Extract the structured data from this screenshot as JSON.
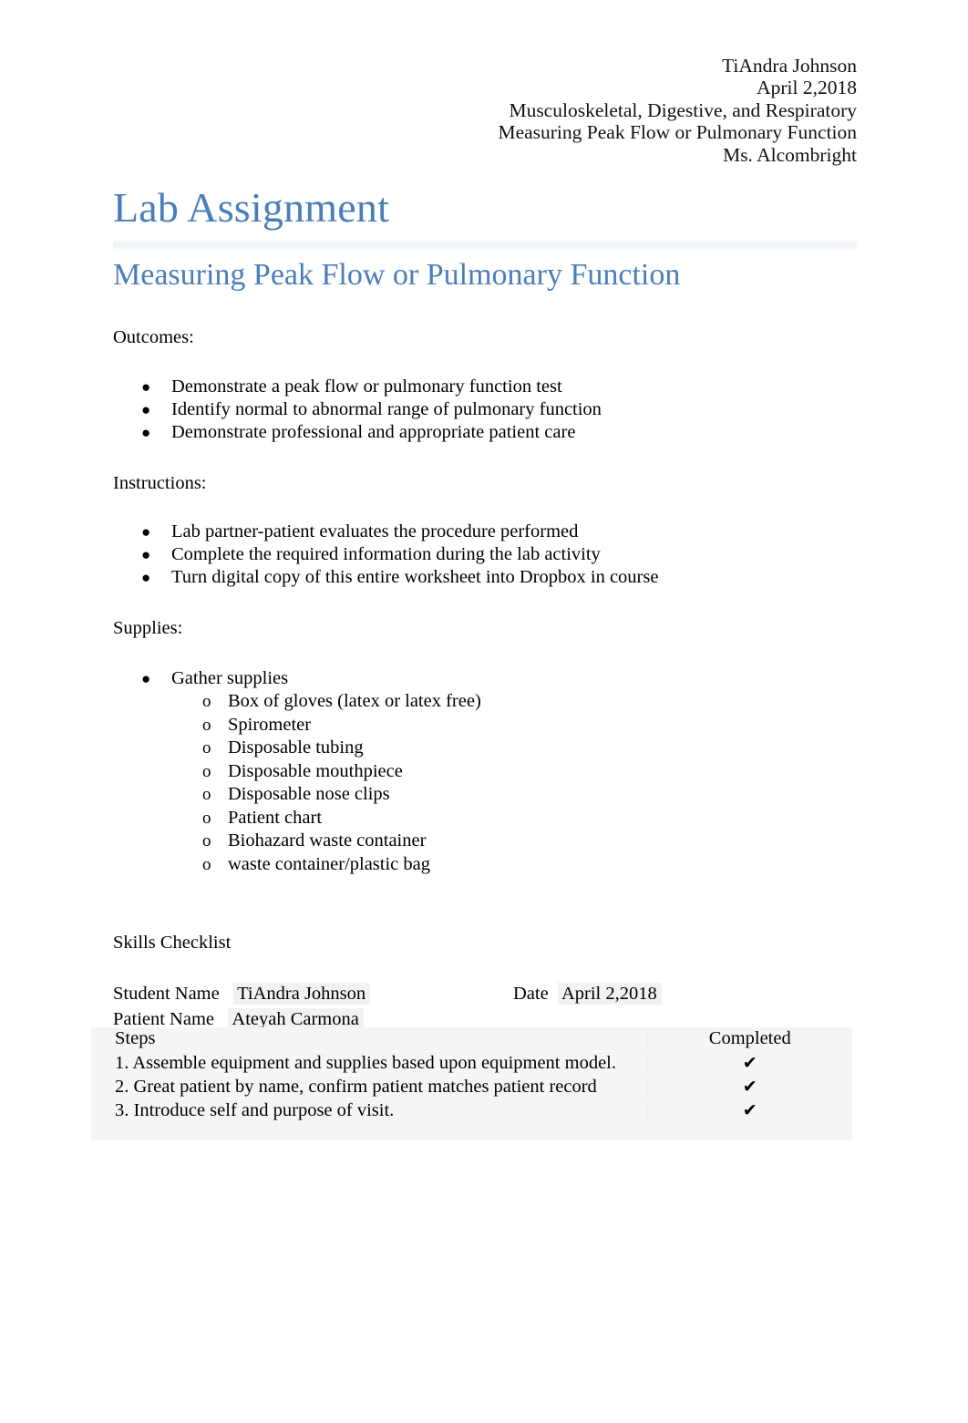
{
  "header": {
    "lines": [
      "TiAndra Johnson",
      "April 2,2018",
      "Musculoskeletal, Digestive, and Respiratory",
      "Measuring Peak Flow or Pulmonary Function",
      "Ms. Alcombright"
    ]
  },
  "title": "Lab Assignment",
  "subtitle": "Measuring Peak Flow or Pulmonary Function",
  "accent_color": "#4a7ebb",
  "sections": {
    "outcomes": {
      "label": "Outcomes:",
      "items": [
        "Demonstrate a peak flow or pulmonary function test",
        "Identify normal to abnormal range of pulmonary function",
        "Demonstrate professional and appropriate patient care"
      ]
    },
    "instructions": {
      "label": "Instructions:",
      "items": [
        "Lab partner-patient evaluates the procedure performed",
        "Complete the required information during the lab activity",
        "Turn digital copy of this entire worksheet into Dropbox in course"
      ]
    },
    "supplies": {
      "label": "Supplies:",
      "items": [
        {
          "text": "Gather supplies",
          "subitems": [
            "Box of gloves (latex or latex free)",
            "Spirometer",
            "Disposable tubing",
            "Disposable mouthpiece",
            "Disposable nose clips",
            "Patient chart",
            "Biohazard waste container",
            "waste container/plastic bag"
          ]
        }
      ]
    }
  },
  "skills": {
    "heading": "Skills Checklist",
    "student_name_label": "Student Name",
    "student_name_value": "TiAndra Johnson",
    "date_label": "Date",
    "date_value": "April 2,2018",
    "patient_name_label": "Patient Name",
    "patient_name_value": "Ateyah Carmona",
    "table": {
      "columns": [
        "Steps",
        "Completed"
      ],
      "rows": [
        {
          "step": "1. Assemble equipment and supplies based upon equipment model.",
          "completed": "✔"
        },
        {
          "step": "2. Great patient by name, confirm patient matches patient record",
          "completed": "✔"
        },
        {
          "step": "3. Introduce self and purpose of visit.",
          "completed": "✔"
        }
      ]
    }
  },
  "markers": {
    "bullet": "●",
    "subbullet": "o"
  }
}
